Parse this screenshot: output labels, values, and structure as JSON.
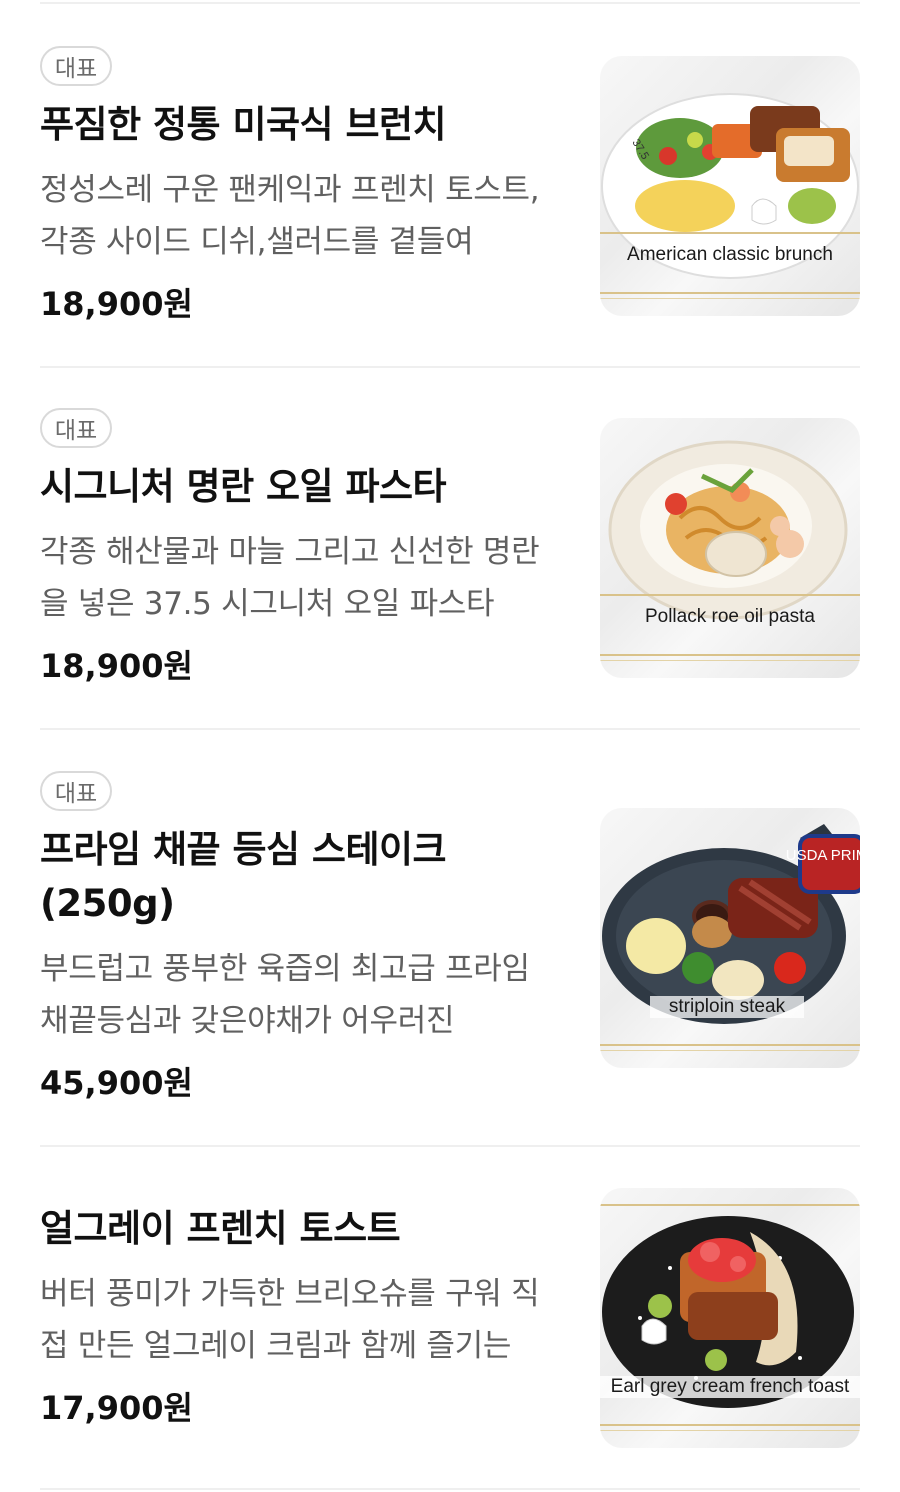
{
  "menu": {
    "items": [
      {
        "badge": "대표",
        "title": "푸짐한 정통 미국식 브런치",
        "description": "정성스레 구운 팬케익과 프렌치 토스트,각종 사이드 디쉬,샐러드를 곁들여",
        "price": "18,900원",
        "image_caption": "American classic brunch",
        "image_overlay_text": "37.5"
      },
      {
        "badge": "대표",
        "title": "시그니처 명란 오일 파스타",
        "description": "각종 해산물과 마늘 그리고 신선한 명란을 넣은 37.5 시그니처 오일 파스타",
        "price": "18,900원",
        "image_caption": "Pollack roe oil pasta"
      },
      {
        "badge": "대표",
        "title": "프라임 채끝 등심 스테이크(250g)",
        "description": "부드럽고 풍부한 육즙의 최고급 프라임 채끝등심과 갖은야채가 어우러진",
        "price": "45,900원",
        "image_caption": "striploin steak",
        "image_overlay_text": "USDA PRIME"
      },
      {
        "title": "얼그레이 프렌치 토스트",
        "description": "버터 풍미가 가득한 브리오슈를 구워 직접 만든 얼그레이 크림과 함께 즐기는",
        "price": "17,900원",
        "image_caption": "Earl grey cream french toast"
      }
    ]
  },
  "colors": {
    "title": "#111111",
    "description": "#606060",
    "badge_border": "#d9d9d9",
    "divider": "#efefef"
  }
}
